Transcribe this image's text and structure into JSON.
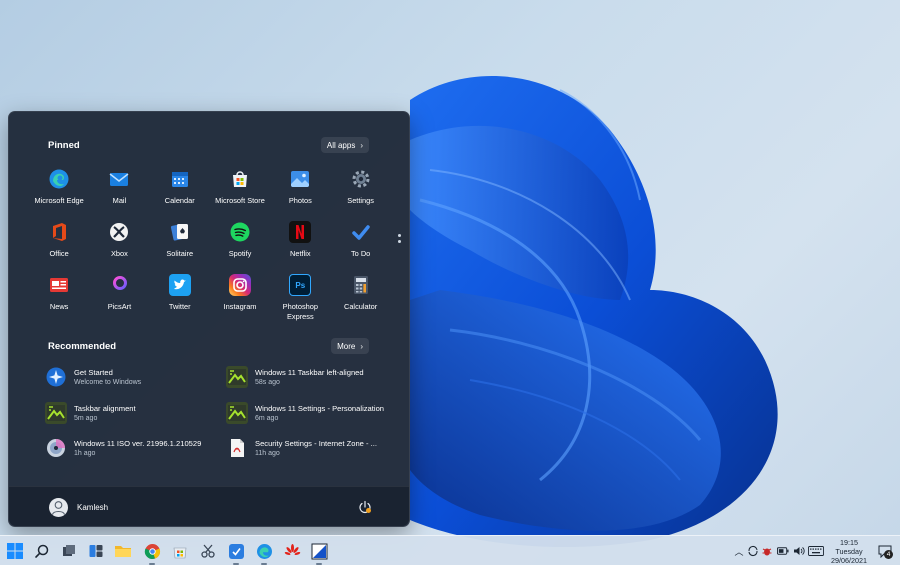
{
  "start_menu": {
    "pinned_title": "Pinned",
    "all_apps_label": "All apps",
    "pinned": [
      {
        "label": "Microsoft Edge",
        "icon": "edge-icon"
      },
      {
        "label": "Mail",
        "icon": "mail-icon"
      },
      {
        "label": "Calendar",
        "icon": "calendar-icon"
      },
      {
        "label": "Microsoft Store",
        "icon": "store-icon"
      },
      {
        "label": "Photos",
        "icon": "photos-icon"
      },
      {
        "label": "Settings",
        "icon": "gear-icon"
      },
      {
        "label": "Office",
        "icon": "office-icon"
      },
      {
        "label": "Xbox",
        "icon": "xbox-icon"
      },
      {
        "label": "Solitaire",
        "icon": "cards-icon"
      },
      {
        "label": "Spotify",
        "icon": "spotify-icon"
      },
      {
        "label": "Netflix",
        "icon": "netflix-icon"
      },
      {
        "label": "To Do",
        "icon": "checkmark-icon"
      },
      {
        "label": "News",
        "icon": "news-icon"
      },
      {
        "label": "PicsArt",
        "icon": "picsart-icon"
      },
      {
        "label": "Twitter",
        "icon": "twitter-icon"
      },
      {
        "label": "Instagram",
        "icon": "instagram-icon"
      },
      {
        "label": "Photoshop Express",
        "icon": "photoshop-icon"
      },
      {
        "label": "Calculator",
        "icon": "calculator-icon"
      }
    ],
    "recommended_title": "Recommended",
    "more_label": "More",
    "recommended": [
      {
        "title": "Get Started",
        "subtitle": "Welcome to Windows",
        "icon": "get-started-icon"
      },
      {
        "title": "Windows 11 Taskbar left-aligned",
        "subtitle": "58s ago",
        "icon": "image-file-icon"
      },
      {
        "title": "Taskbar alignment",
        "subtitle": "5m ago",
        "icon": "image-file-icon"
      },
      {
        "title": "Windows 11 Settings - Personalization",
        "subtitle": "6m ago",
        "icon": "image-file-icon"
      },
      {
        "title": "Windows 11 ISO ver. 21996.1.210529",
        "subtitle": "1h ago",
        "icon": "disc-image-icon"
      },
      {
        "title": "Security Settings - Internet Zone - ...",
        "subtitle": "11h ago",
        "icon": "pdf-file-icon"
      }
    ],
    "user_name": "Kamlesh"
  },
  "taskbar": {
    "clock": {
      "time": "19:15",
      "day": "Tuesday",
      "date": "29/06/2021"
    },
    "notification_count": "4"
  },
  "colors": {
    "menu_bg": "#202a3a",
    "accent": "#0a64d8",
    "wallpaper_blue": "#0b4ed6",
    "taskbar_bg": "#d2dfec"
  }
}
